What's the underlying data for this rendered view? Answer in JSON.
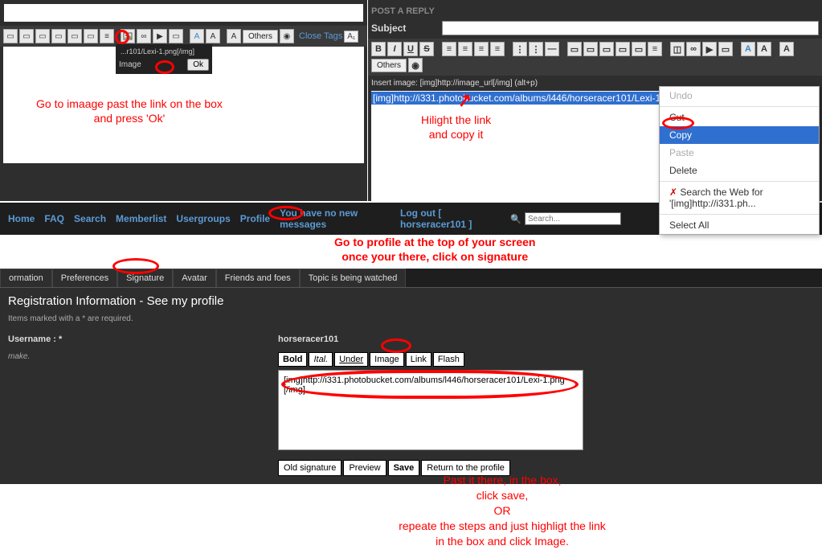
{
  "panel1": {
    "others": "Others",
    "close_tags": "Close Tags",
    "ab": "A₁",
    "popup": {
      "header": "...r101/Lexi-1.png[/img]",
      "label": "Image",
      "ok": "Ok"
    },
    "annotation": "Go to imaage past the link on the box\nand press 'Ok'"
  },
  "panel2": {
    "post_reply": "POST A REPLY",
    "subject_label": "Subject",
    "fmt": {
      "b": "B",
      "i": "I",
      "u": "U",
      "s": "S"
    },
    "others": "Others",
    "insert_label": "Insert image: [img]http://image_url[/img] (alt+p)",
    "selected_text": "[img]http://i331.photobucket.com/albums/l446/horseracer101/Lexi-1.png[/img]",
    "ctx": {
      "undo": "Undo",
      "cut": "Cut",
      "copy": "Copy",
      "paste": "Paste",
      "delete": "Delete",
      "search": "Search the Web for '[img]http://i331.ph...",
      "select_all": "Select All"
    },
    "annotation": "Hilight the link\nand copy it"
  },
  "panel3": {
    "nav": {
      "home": "Home",
      "faq": "FAQ",
      "search": "Search",
      "memberlist": "Memberlist",
      "usergroups": "Usergroups",
      "profile": "Profile",
      "messages": "You have no new messages",
      "logout": "Log out [ horseracer101 ]",
      "search_icon": "🔍",
      "search_placeholder": "Search..."
    },
    "anno_nav": "Go to profile at the top of your screen\nonce your there, click on signature",
    "tabs": {
      "information": "ormation",
      "preferences": "Preferences",
      "signature": "Signature",
      "avatar": "Avatar",
      "friends": "Friends and foes",
      "watched": "Topic is being watched"
    },
    "reg_title": "Registration Information - See my profile",
    "reg_note": "Items marked with a * are required.",
    "username_label": "Username : *",
    "username_value": "horseracer101",
    "make": "make.",
    "sigbtns": {
      "bold": "Bold",
      "ital": "Ital.",
      "under": "Under",
      "image": "Image",
      "link": "Link",
      "flash": "Flash"
    },
    "sig_text": "[img]http://i331.photobucket.com/albums/l446/horseracer101/Lexi-1.png\n[/img]",
    "bottom": {
      "old": "Old signature",
      "preview": "Preview",
      "save": "Save",
      "return": "Return to the profile"
    },
    "anno_bottom": "Past it there, in the box,\nclick save,\nOR\nrepeate the steps and just highligt the link\nin the box and click Image."
  }
}
